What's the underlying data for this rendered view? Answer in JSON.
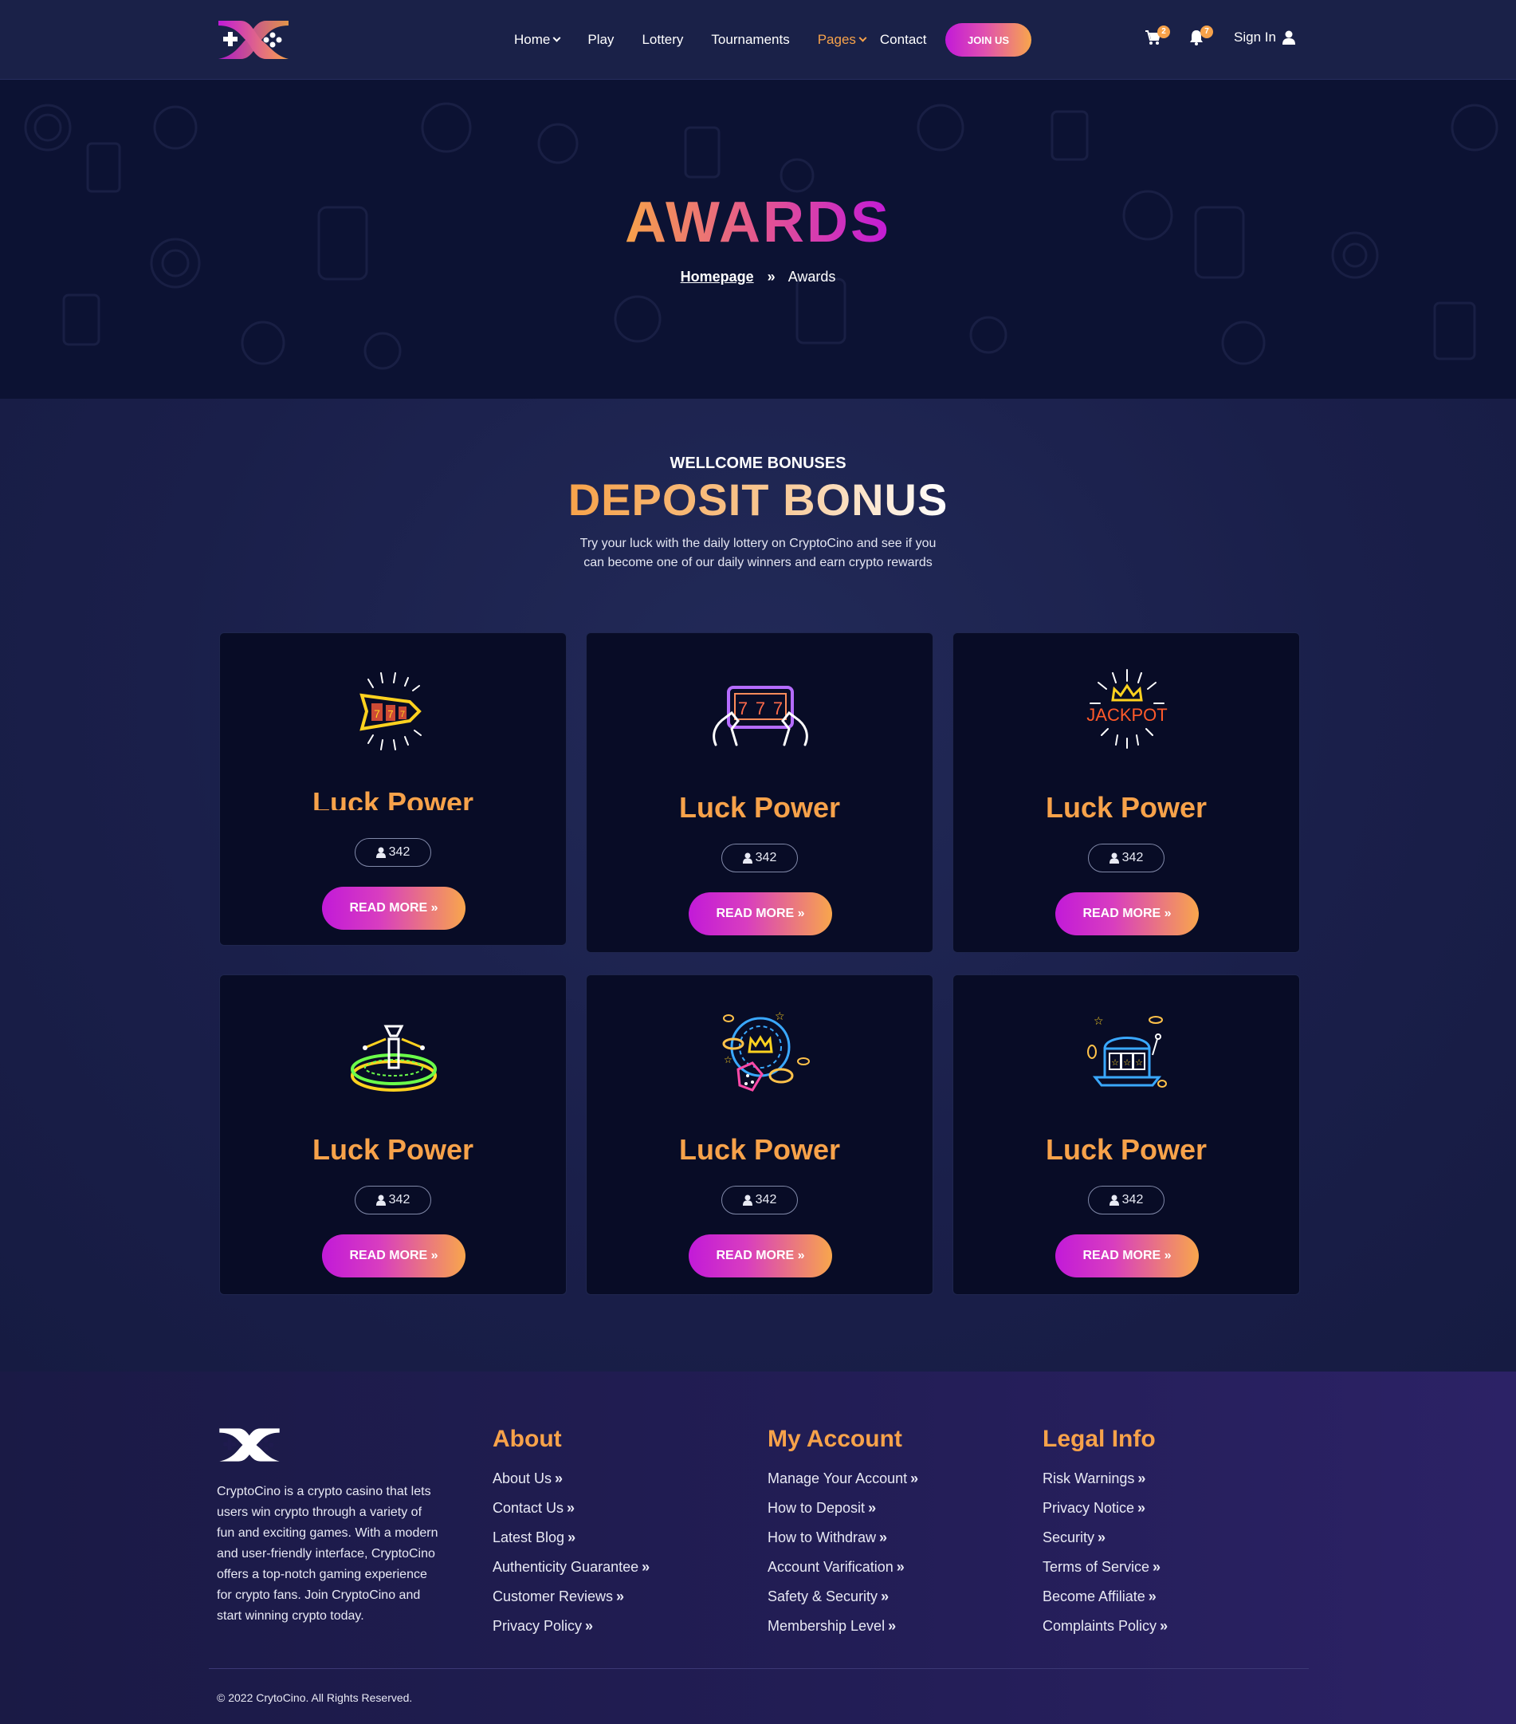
{
  "header": {
    "nav": [
      {
        "label": "Home",
        "dropdown": true,
        "active": false
      },
      {
        "label": "Play",
        "dropdown": false,
        "active": false
      },
      {
        "label": "Lottery",
        "dropdown": false,
        "active": false
      },
      {
        "label": "Tournaments",
        "dropdown": false,
        "active": false
      },
      {
        "label": "Pages",
        "dropdown": true,
        "active": true
      },
      {
        "label": "Contact",
        "dropdown": false,
        "active": false
      }
    ],
    "join_label": "JOIN US",
    "cart_count": "2",
    "notif_count": "7",
    "signin_label": "Sign In"
  },
  "hero": {
    "title": "AWARDS",
    "breadcrumb_home": "Homepage",
    "breadcrumb_current": "Awards"
  },
  "section": {
    "subtitle": "WELLCOME BONUSES",
    "title": "DEPOSIT BONUS",
    "description": "Try your luck with the daily lottery on CryptoCino and see if you can become one of our daily winners and earn crypto rewards"
  },
  "cards": [
    {
      "icon": "slot-reels-icon",
      "title": "Luck Power",
      "count": "342",
      "button": "READ MORE"
    },
    {
      "icon": "phone-777-icon",
      "title": "Luck Power",
      "count": "342",
      "button": "READ MORE"
    },
    {
      "icon": "jackpot-crown-icon",
      "title": "Luck Power",
      "count": "342",
      "button": "READ MORE"
    },
    {
      "icon": "roulette-wheel-icon",
      "title": "Luck Power",
      "count": "342",
      "button": "READ MORE"
    },
    {
      "icon": "dice-crown-chips-icon",
      "title": "Luck Power",
      "count": "342",
      "button": "READ MORE"
    },
    {
      "icon": "laptop-slot-icon",
      "title": "Luck Power",
      "count": "342",
      "button": "READ MORE"
    }
  ],
  "footer": {
    "about_text": "CryptoCino is a crypto casino that lets users win crypto through a variety of fun and exciting games. With a modern and user-friendly interface, CryptoCino offers a top-notch gaming experience for crypto fans. Join CryptoCino and start winning crypto today.",
    "columns": [
      {
        "title": "About",
        "links": [
          "About Us",
          "Contact Us",
          "Latest Blog",
          "Authenticity Guarantee",
          "Customer Reviews",
          "Privacy Policy"
        ]
      },
      {
        "title": "My Account",
        "links": [
          "Manage Your Account",
          "How to Deposit",
          "How to Withdraw",
          "Account Varification",
          "Safety & Security",
          "Membership Level"
        ]
      },
      {
        "title": "Legal Info",
        "links": [
          "Risk Warnings",
          "Privacy Notice",
          "Security",
          "Terms of Service",
          "Become Affiliate",
          "Complaints Policy"
        ]
      }
    ],
    "copyright": "© 2022 CrytoCino. All Rights Reserved."
  },
  "colors": {
    "accent_orange": "#f7a24a",
    "accent_purple": "#c21ad8",
    "card_bg": "#080c26",
    "hero_bg": "#0c1233"
  }
}
